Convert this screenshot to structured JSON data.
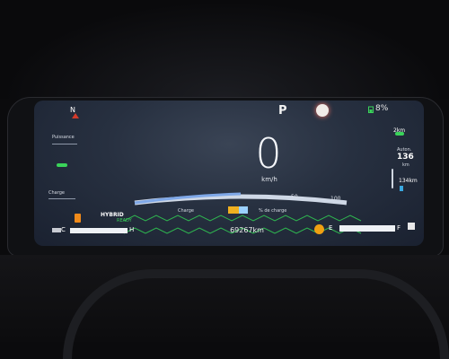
{
  "cluster": {
    "heading": "N",
    "gear": "P",
    "battery_percent": "8%",
    "speed_value": "0",
    "speed_unit": "km/h",
    "odometer": "69267km",
    "power_label": "Puissance",
    "charge_label": "Charge",
    "charge_scale_label": "Charge",
    "charge_percent_label": "% de charge",
    "scale_50": "50",
    "scale_100": "100",
    "hybrid_label": "HYBRID",
    "ready_label": "READY",
    "ev_range_value": "2km",
    "autonomy_label": "Auton.",
    "autonomy_value": "136",
    "autonomy_unit": "km",
    "range_bottom": "134km",
    "temp_cold": "C",
    "temp_hot": "H",
    "fuel_empty": "E",
    "fuel_full": "F"
  },
  "colors": {
    "screen_blue": "#273040",
    "green_accent": "#3ad35a",
    "warning_red": "#e03a2a",
    "orange": "#f08a1a"
  },
  "icons": [
    "compass-icon",
    "gear-indicator",
    "red-warning-light",
    "battery-icon",
    "ev-car-icon",
    "hybrid-car-icon",
    "fuel-pump-icon",
    "seatbelt-icon",
    "door-icon",
    "oil-warning-icon"
  ]
}
